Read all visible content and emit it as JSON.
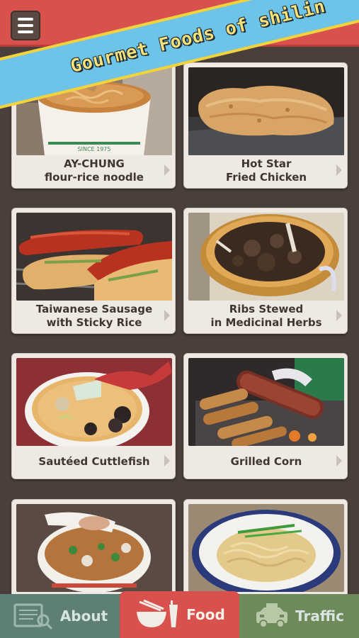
{
  "header": {
    "title": "Gourmet Foods of shilin",
    "menu_icon": "hamburger-menu-icon"
  },
  "cards": [
    {
      "line1": "AY-CHUNG",
      "line2": "flour-rice noodle"
    },
    {
      "line1": "Hot Star",
      "line2": "Fried Chicken"
    },
    {
      "line1": "Taiwanese Sausage",
      "line2": "with Sticky Rice"
    },
    {
      "line1": "Ribs Stewed",
      "line2": "in Medicinal Herbs"
    },
    {
      "line1": "Sautéed Cuttlefish",
      "line2": ""
    },
    {
      "line1": "Grilled Corn",
      "line2": ""
    },
    {
      "line1": "",
      "line2": ""
    },
    {
      "line1": "",
      "line2": ""
    }
  ],
  "tabs": {
    "about": "About",
    "food": "Food",
    "traffic": "Traffic",
    "active": "Food"
  },
  "colors": {
    "header": "#d9514d",
    "banner": "#6ec3e8",
    "banner_border": "#f4d23a",
    "background": "#4a3f3a",
    "tab_about": "#5d7f76",
    "tab_food": "#d9514d",
    "tab_traffic": "#6e8a5a"
  }
}
